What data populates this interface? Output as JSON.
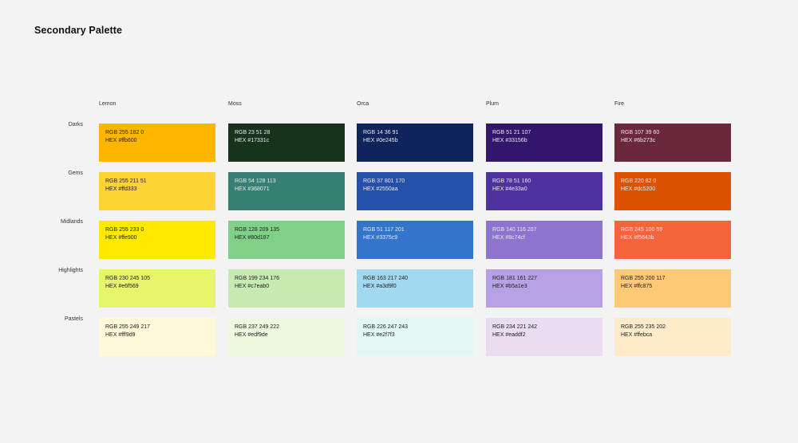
{
  "title": "Secondary Palette",
  "columns": [
    "Lemon",
    "Moss",
    "Orca",
    "Plum",
    "Fire"
  ],
  "rows": [
    "Darks",
    "Gems",
    "Midlands",
    "Highlights",
    "Pastels"
  ],
  "swatches": [
    [
      {
        "rgb": "RGB 255 182 0",
        "hex": "HEX #ffb600",
        "color": "#ffb600"
      },
      {
        "rgb": "RGB 23 51 28",
        "hex": "HEX #17331c",
        "color": "#17331c"
      },
      {
        "rgb": "RGB 14 36 91",
        "hex": "HEX #0e245b",
        "color": "#0e245b"
      },
      {
        "rgb": "RGB 51 21 107",
        "hex": "HEX #33156b",
        "color": "#33156b"
      },
      {
        "rgb": "RGB 107 39 60",
        "hex": "HEX #6b273c",
        "color": "#6b273c"
      }
    ],
    [
      {
        "rgb": "RGB 255 211 51",
        "hex": "HEX #ffd333",
        "color": "#ffd333"
      },
      {
        "rgb": "RGB 54 128 113",
        "hex": "HEX #368071",
        "color": "#368071"
      },
      {
        "rgb": "RGB 37 801 170",
        "hex": "HEX #2550aa",
        "color": "#2550aa"
      },
      {
        "rgb": "RGB 78 51 160",
        "hex": "HEX #4e33a0",
        "color": "#4e33a0"
      },
      {
        "rgb": "RGB 220 82 0",
        "hex": "HEX #dc5200",
        "color": "#dc5200"
      }
    ],
    [
      {
        "rgb": "RGB 255 233 0",
        "hex": "HEX #ffe900",
        "color": "#ffe900"
      },
      {
        "rgb": "RGB 128 209 135",
        "hex": "HEX #80d187",
        "color": "#80d187"
      },
      {
        "rgb": "RGB 51 117 201",
        "hex": "HEX #3375c9",
        "color": "#3375c9"
      },
      {
        "rgb": "RGB 140 116 207",
        "hex": "HEX #8c74cf",
        "color": "#8c74cf"
      },
      {
        "rgb": "RGB 245 100 59",
        "hex": "HEX #f5643b",
        "color": "#f5643b"
      }
    ],
    [
      {
        "rgb": "RGB 230 245 105",
        "hex": "HEX #e6f569",
        "color": "#e6f569"
      },
      {
        "rgb": "RGB 199 234 176",
        "hex": "HEX #c7eab0",
        "color": "#c7eab0"
      },
      {
        "rgb": "RGB 163 217 240",
        "hex": "HEX #a3d9f0",
        "color": "#a3d9f0"
      },
      {
        "rgb": "RGB 181 161 227",
        "hex": "HEX #b5a1e3",
        "color": "#b5a1e3"
      },
      {
        "rgb": "RGB 255 200 117",
        "hex": "HEX #ffc875",
        "color": "#ffc875"
      }
    ],
    [
      {
        "rgb": "RGB 255 249 217",
        "hex": "HEX #fff9d9",
        "color": "#fff9d9"
      },
      {
        "rgb": "RGB 237 249 222",
        "hex": "HEX #edf9de",
        "color": "#edf9de"
      },
      {
        "rgb": "RGB 226 247 243",
        "hex": "HEX #e2f7f3",
        "color": "#e2f7f3"
      },
      {
        "rgb": "RGB 234 221 242",
        "hex": "HEX #eaddf2",
        "color": "#eaddf2"
      },
      {
        "rgb": "RGB 255 235 202",
        "hex": "HEX #ffebca",
        "color": "#ffebca"
      }
    ]
  ]
}
